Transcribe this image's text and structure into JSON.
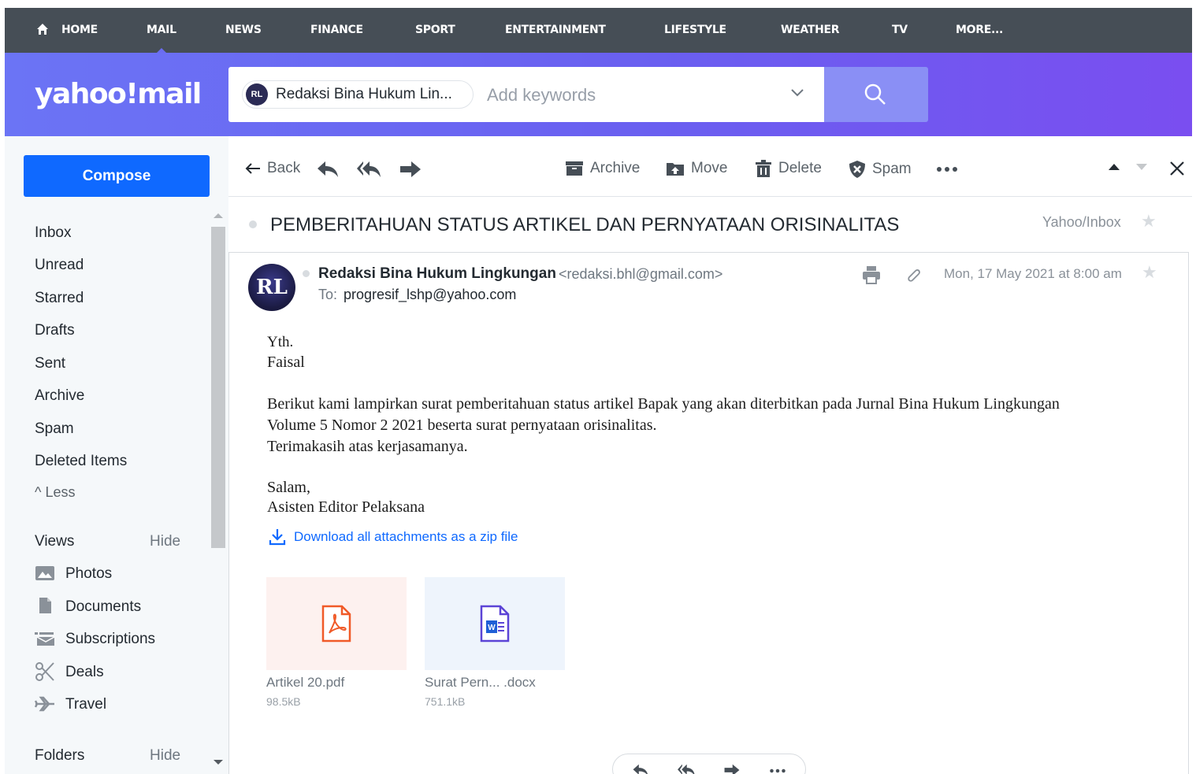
{
  "topnav": {
    "items": [
      {
        "label": "HOME"
      },
      {
        "label": "MAIL"
      },
      {
        "label": "NEWS"
      },
      {
        "label": "FINANCE"
      },
      {
        "label": "SPORT"
      },
      {
        "label": "ENTERTAINMENT"
      },
      {
        "label": "LIFESTYLE"
      },
      {
        "label": "WEATHER"
      },
      {
        "label": "TV"
      },
      {
        "label": "MORE..."
      }
    ],
    "active": "MAIL"
  },
  "header": {
    "logo": "yahoo!mail",
    "search": {
      "chip_avatar": "RL",
      "chip_label": "Redaksi Bina Hukum Lin...",
      "placeholder": "Add keywords"
    }
  },
  "sidebar": {
    "compose_label": "Compose",
    "folders": [
      {
        "label": "Inbox"
      },
      {
        "label": "Unread"
      },
      {
        "label": "Starred"
      },
      {
        "label": "Drafts"
      },
      {
        "label": "Sent"
      },
      {
        "label": "Archive"
      },
      {
        "label": "Spam"
      },
      {
        "label": "Deleted Items"
      }
    ],
    "less_label": "Less",
    "views": {
      "title": "Views",
      "hide": "Hide",
      "items": [
        {
          "label": "Photos",
          "icon": "photos-icon"
        },
        {
          "label": "Documents",
          "icon": "documents-icon"
        },
        {
          "label": "Subscriptions",
          "icon": "subscriptions-icon"
        },
        {
          "label": "Deals",
          "icon": "scissors-icon"
        },
        {
          "label": "Travel",
          "icon": "airplane-icon"
        }
      ]
    },
    "folders_section": {
      "title": "Folders",
      "hide": "Hide"
    }
  },
  "toolbar": {
    "back": "Back",
    "archive": "Archive",
    "move": "Move",
    "delete": "Delete",
    "spam": "Spam"
  },
  "message": {
    "subject": "PEMBERITAHUAN STATUS ARTIKEL DAN PERNYATAAN ORISINALITAS",
    "folder_path": "Yahoo/Inbox",
    "sender_avatar": "RL",
    "sender_name": "Redaksi Bina Hukum Lingkungan",
    "sender_email": "<redaksi.bhl@gmail.com>",
    "to_label": "To:",
    "to_value": "progresif_lshp@yahoo.com",
    "date": "Mon, 17 May 2021 at 8:00 am",
    "body": {
      "greeting1": "Yth.",
      "greeting2": "Faisal",
      "line1": "Berikut kami lampirkan surat pemberitahuan status artikel Bapak yang akan diterbitkan pada Jurnal Bina Hukum Lingkungan",
      "line2": "Volume 5 Nomor 2 2021 beserta surat pernyataan orisinalitas.",
      "line3": "Terimakasih atas kerjasamanya.",
      "closing1": "Salam,",
      "closing2": "Asisten Editor Pelaksana"
    },
    "download_all": "Download all attachments as a zip file",
    "attachments": [
      {
        "name": "Artikel 20.pdf",
        "size": "98.5kB",
        "type": "pdf",
        "thumb_color": "#fdf1ef"
      },
      {
        "name": "Surat Pern... .docx",
        "size": "751.1kB",
        "type": "docx",
        "thumb_color": "#eef4fc"
      }
    ]
  },
  "colors": {
    "nav_bg": "#464e56",
    "header_gradient_start": "#6b74f5",
    "header_gradient_end": "#7a4ef0",
    "compose": "#0f69ff",
    "search_button": "#8a8ff5",
    "link": "#0f69ff"
  }
}
